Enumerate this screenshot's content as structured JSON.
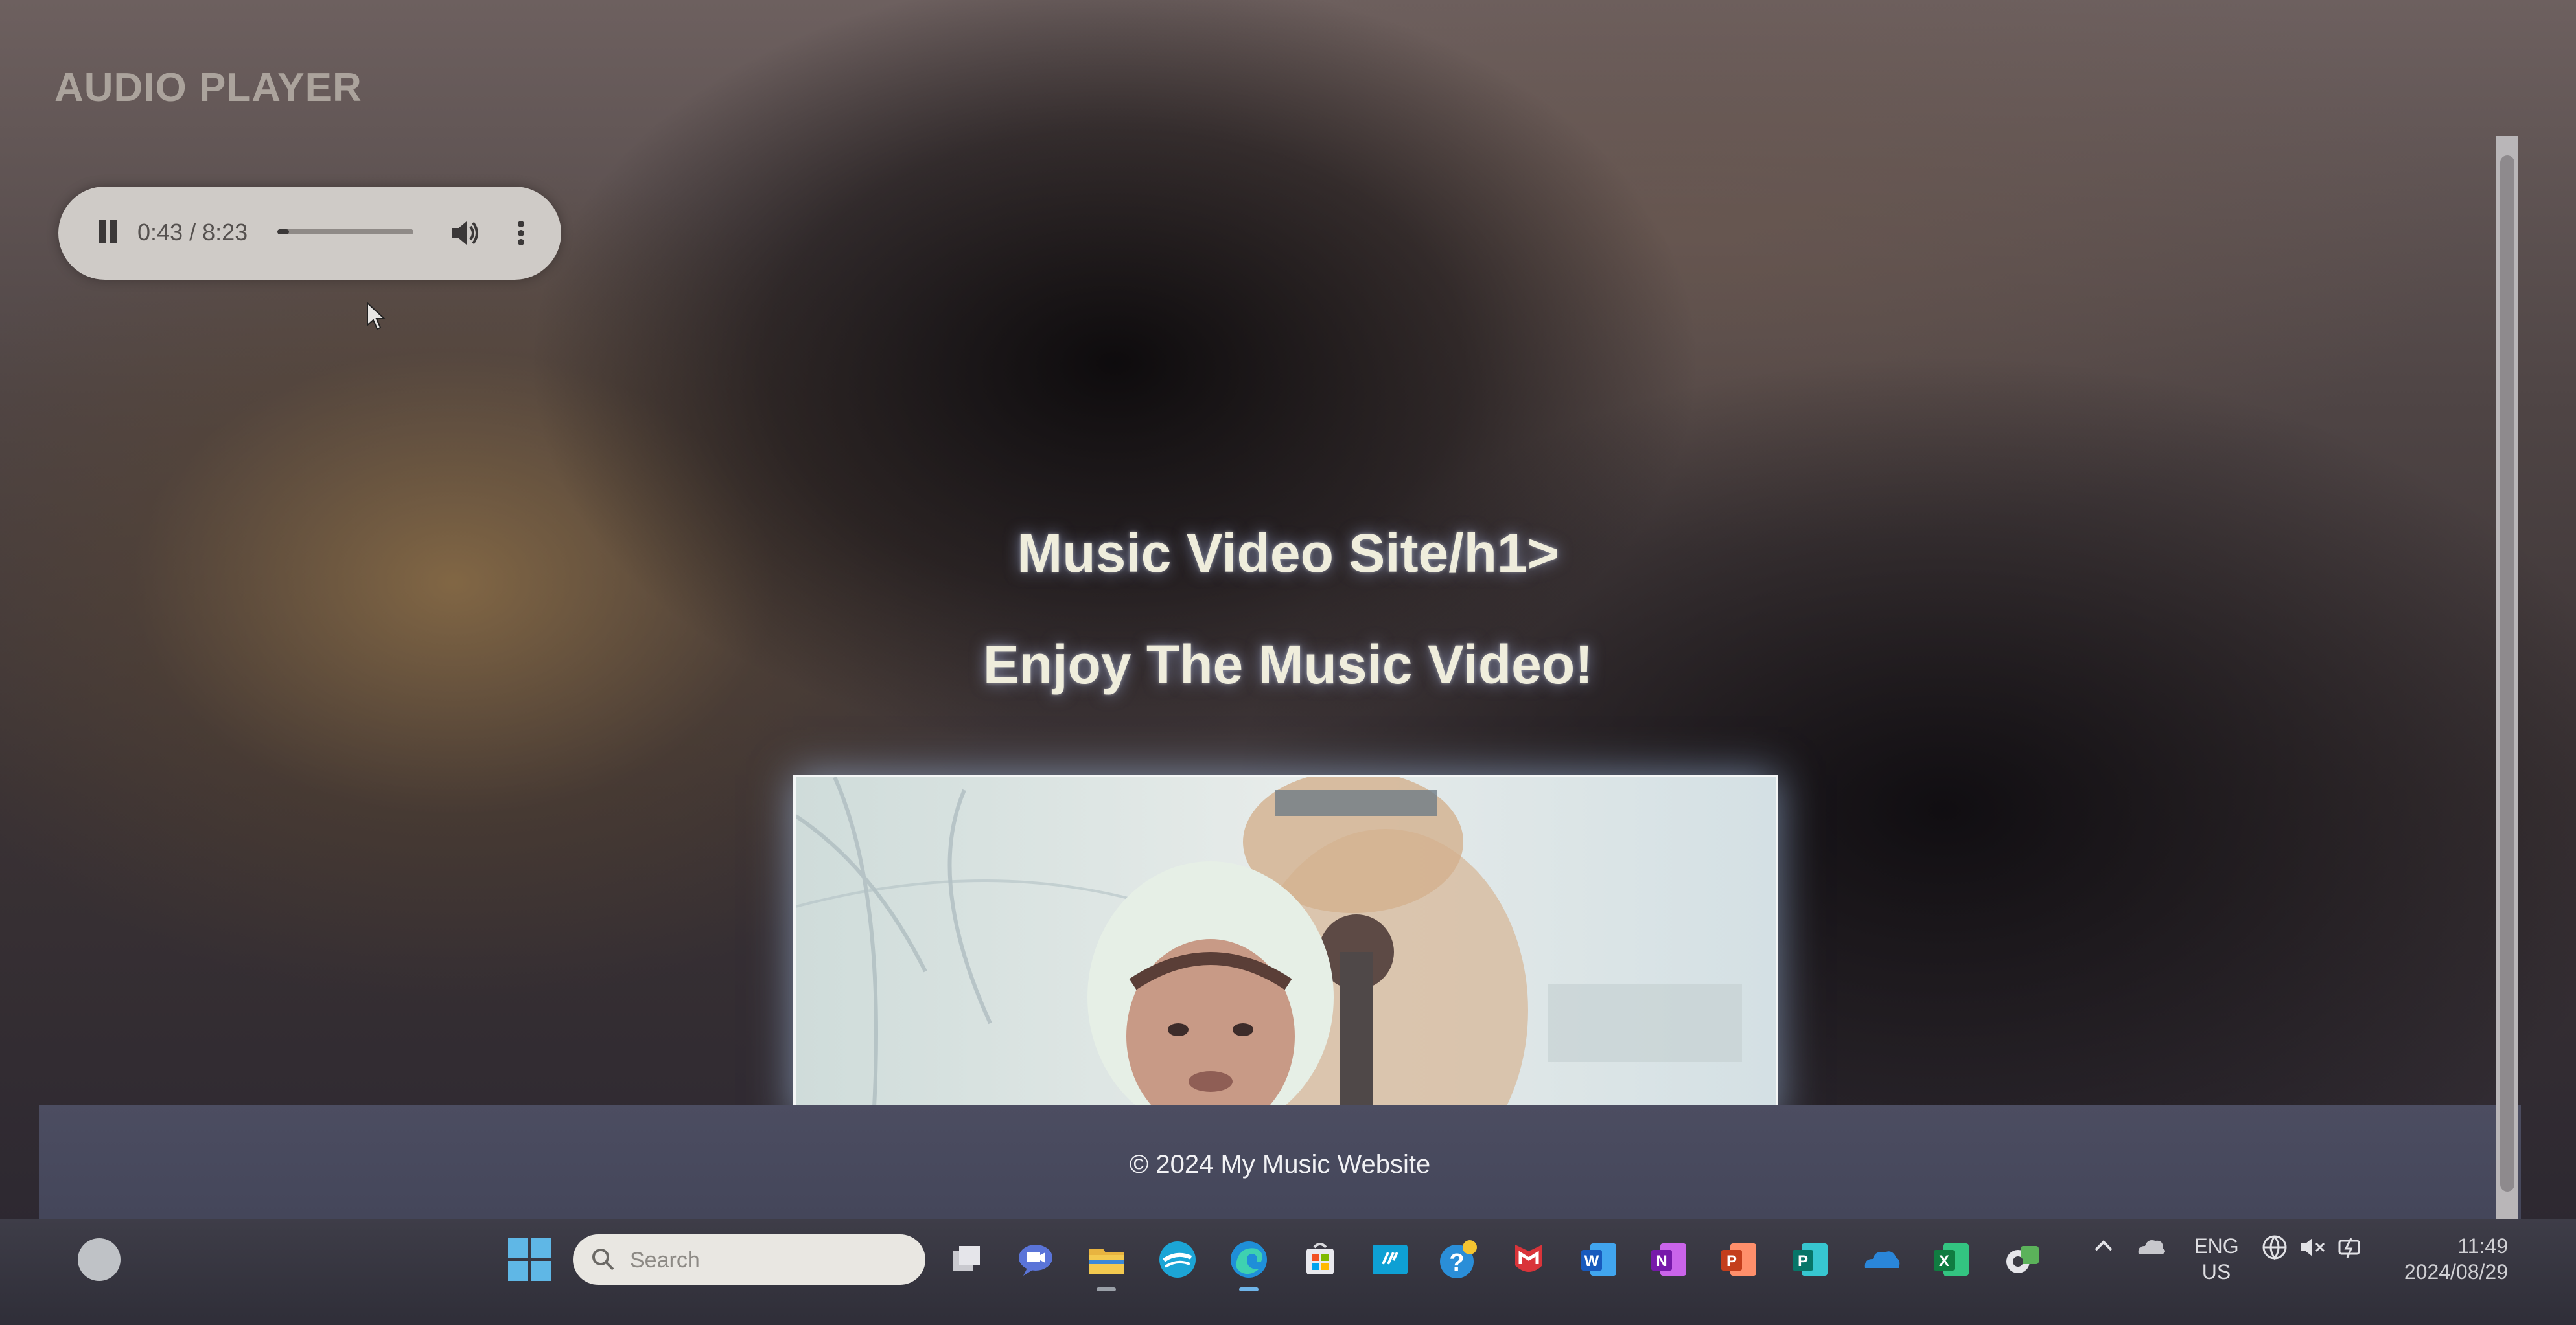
{
  "page": {
    "app_title": "AUDIO PLAYER",
    "heading": "Music Video Site/h1>",
    "subheading": "Enjoy The Music Video!",
    "footer_text": "© 2024 My Music Website"
  },
  "audio_player": {
    "state": "playing",
    "time_display": "0:43 / 8:23",
    "progress_fraction": 0.085
  },
  "video": {
    "description": "music video frame"
  },
  "taskbar": {
    "search_placeholder": "Search",
    "apps": [
      "task-view",
      "teams-meet",
      "file-explorer",
      "browser-edge-dev",
      "edge",
      "microsoft-store",
      "hp-smart",
      "get-help",
      "mcafee",
      "word",
      "onenote",
      "powerpoint",
      "publisher",
      "onedrive",
      "excel",
      "app-switcher"
    ],
    "language_line1": "ENG",
    "language_line2": "US",
    "time": "11:49",
    "date": "2024/08/29"
  },
  "colors": {
    "heading_text": "#efeddc",
    "player_bg": "#cfcbc7",
    "footer_bg": "#4c4d61",
    "taskbar_bg": "#3e3d48"
  }
}
